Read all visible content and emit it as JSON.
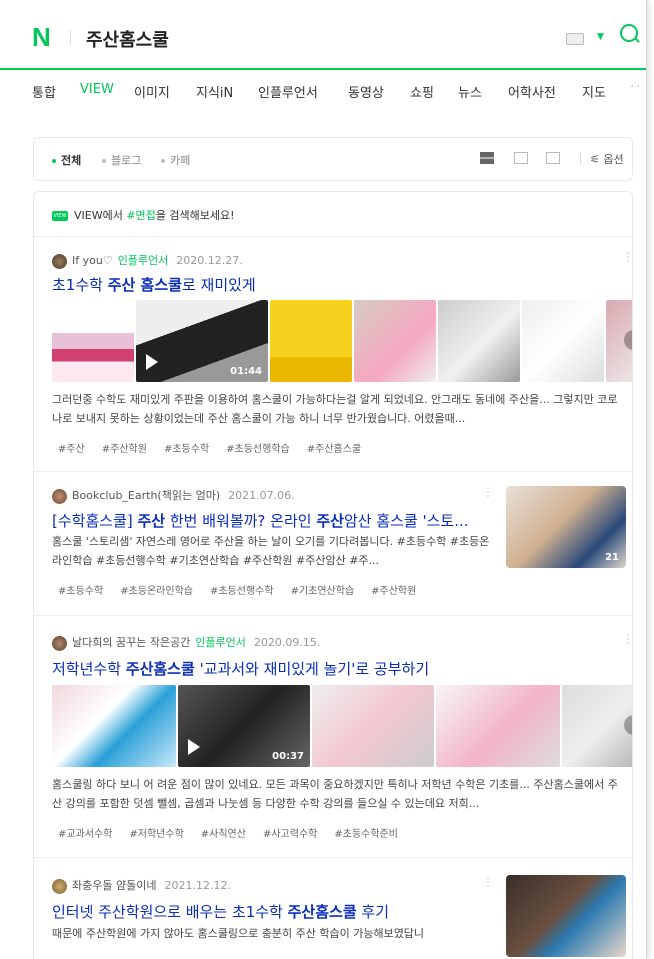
{
  "header": {
    "logo": "N",
    "query": "주산홈스쿨"
  },
  "tabs": [
    {
      "label": "통합",
      "active": false
    },
    {
      "label": "VIEW",
      "active": true
    },
    {
      "label": "이미지",
      "active": false
    },
    {
      "label": "지식iN",
      "active": false
    },
    {
      "label": "인플루언서",
      "active": false
    },
    {
      "label": "동영상",
      "active": false
    },
    {
      "label": "쇼핑",
      "active": false
    },
    {
      "label": "뉴스",
      "active": false
    },
    {
      "label": "어학사전",
      "active": false
    },
    {
      "label": "지도",
      "active": false
    }
  ],
  "filters": {
    "all": "전체",
    "blog": "블로그",
    "cafe": "카페",
    "options": "옵션"
  },
  "notice": {
    "badge": "VIEW",
    "prefix": "VIEW에서 ",
    "keyword": "#면접",
    "suffix": "을 검색해보세요!"
  },
  "results": [
    {
      "author": "If you♡",
      "badge": "인플루언서",
      "date": "2020.12.27.",
      "title_parts": [
        "초1수학 ",
        "주산 홈스쿨",
        "로 재미있게"
      ],
      "duration": "01:44",
      "desc": "그러던중 수학도 재미있게 주판을 이용하여 홈스쿨이 가능하다는걸 알게 되었네요. 안그래도 동네에 주산을... 그렇지만 코로나로 보내지 못하는 상황이었는데 주산 홈스쿨이 가능 하니 너무 반가웠습니다. 어렸을때...",
      "tags": [
        "#주산",
        "#주산학원",
        "#초등수학",
        "#초등선행학습",
        "#주산홈스쿨"
      ]
    },
    {
      "author": "Bookclub_Earth(책읽는 엄마)",
      "badge": "",
      "date": "2021.07.06.",
      "title_parts": [
        "[수학홈스쿨] ",
        "주산",
        " 한번 배워볼까? 온라인 ",
        "주산",
        "암산 홈스쿨 '스토..."
      ],
      "desc": "홈스쿨 '스토리샘' 자연스레 영어로 주산을 하는 날이 오기를 기다려봅니다. #초등수학 #초등온라인학습 #초등선행수학 #기초연산학습 #주산학원 #주산암산 #주...",
      "image_count": "21",
      "tags": [
        "#초등수학",
        "#초등온라인학습",
        "#초등선행수학",
        "#기초연산학습",
        "#주산학원"
      ]
    },
    {
      "author": "날다희의 꿈꾸는 작은공간",
      "badge": "인플루언서",
      "date": "2020.09.15.",
      "title_parts": [
        "저학년수학 ",
        "주산홈스쿨",
        " '교과서와 재미있게 놀기'로 공부하기"
      ],
      "duration": "00:37",
      "desc": "홈스쿨링 하다 보니 어 려운 점이 많이 있네요. 모든 과목이 중요하겠지만 특히나 저학년 수학은 기초를... 주산홈스쿨에서 주산 강의를 포함한 덧셈 뺄셈, 곱셈과 나눗셈 등 다양한 수학 강의를 들으실 수 있는데요 저희...",
      "tags": [
        "#교과서수학",
        "#저학년수학",
        "#사칙연산",
        "#사고력수학",
        "#초등수학준비"
      ]
    },
    {
      "author": "좌충우돌 얌돌이네",
      "badge": "",
      "date": "2021.12.12.",
      "title_parts": [
        "인터넷 주산학원으로 배우는 초1수학 ",
        "주산홈스쿨",
        " 후기"
      ],
      "desc": "때문에 주산학원에 가지 않아도 홈스쿨링으로 충분히 주산 학습이 가능해보였답니"
    }
  ]
}
